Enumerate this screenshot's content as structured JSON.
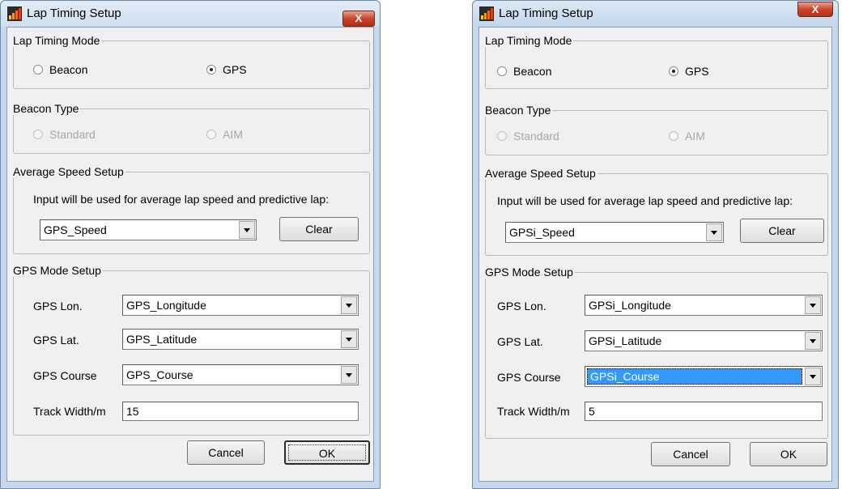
{
  "dialogs": [
    {
      "title": "Lap Timing Setup",
      "close_label": "X",
      "lap_timing_mode": {
        "legend": "Lap Timing Mode",
        "options": [
          "Beacon",
          "GPS"
        ],
        "selected": "GPS"
      },
      "beacon_type": {
        "legend": "Beacon Type",
        "options": [
          "Standard",
          "AIM"
        ],
        "enabled": false
      },
      "average_speed": {
        "legend": "Average Speed Setup",
        "description": "Input will be used for average lap speed and predictive lap:",
        "value": "GPS_Speed",
        "clear_label": "Clear"
      },
      "gps_mode": {
        "legend": "GPS Mode Setup",
        "lon_label": "GPS Lon.",
        "lon_value": "GPS_Longitude",
        "lat_label": "GPS Lat.",
        "lat_value": "GPS_Latitude",
        "course_label": "GPS Course",
        "course_value": "GPS_Course",
        "track_label": "Track Width/m",
        "track_value": "15"
      },
      "cancel_label": "Cancel",
      "ok_label": "OK"
    },
    {
      "title": "Lap Timing Setup",
      "close_label": "X",
      "lap_timing_mode": {
        "legend": "Lap Timing Mode",
        "options": [
          "Beacon",
          "GPS"
        ],
        "selected": "GPS"
      },
      "beacon_type": {
        "legend": "Beacon Type",
        "options": [
          "Standard",
          "AIM"
        ],
        "enabled": false
      },
      "average_speed": {
        "legend": "Average Speed Setup",
        "description": "Input will be used for average lap speed and predictive lap:",
        "value": "GPSi_Speed",
        "clear_label": "Clear"
      },
      "gps_mode": {
        "legend": "GPS Mode Setup",
        "lon_label": "GPS Lon.",
        "lon_value": "GPSi_Longitude",
        "lat_label": "GPS Lat.",
        "lat_value": "GPSi_Latitude",
        "course_label": "GPS Course",
        "course_value": "GPSi_Course",
        "track_label": "Track Width/m",
        "track_value": "5"
      },
      "cancel_label": "Cancel",
      "ok_label": "OK"
    }
  ],
  "colors": {
    "selection": "#3399ff",
    "close_button": "#c8442a",
    "client_bg": "#f0f0f0"
  },
  "icons": {
    "app": "bar-chart-icon",
    "close": "close-icon"
  }
}
